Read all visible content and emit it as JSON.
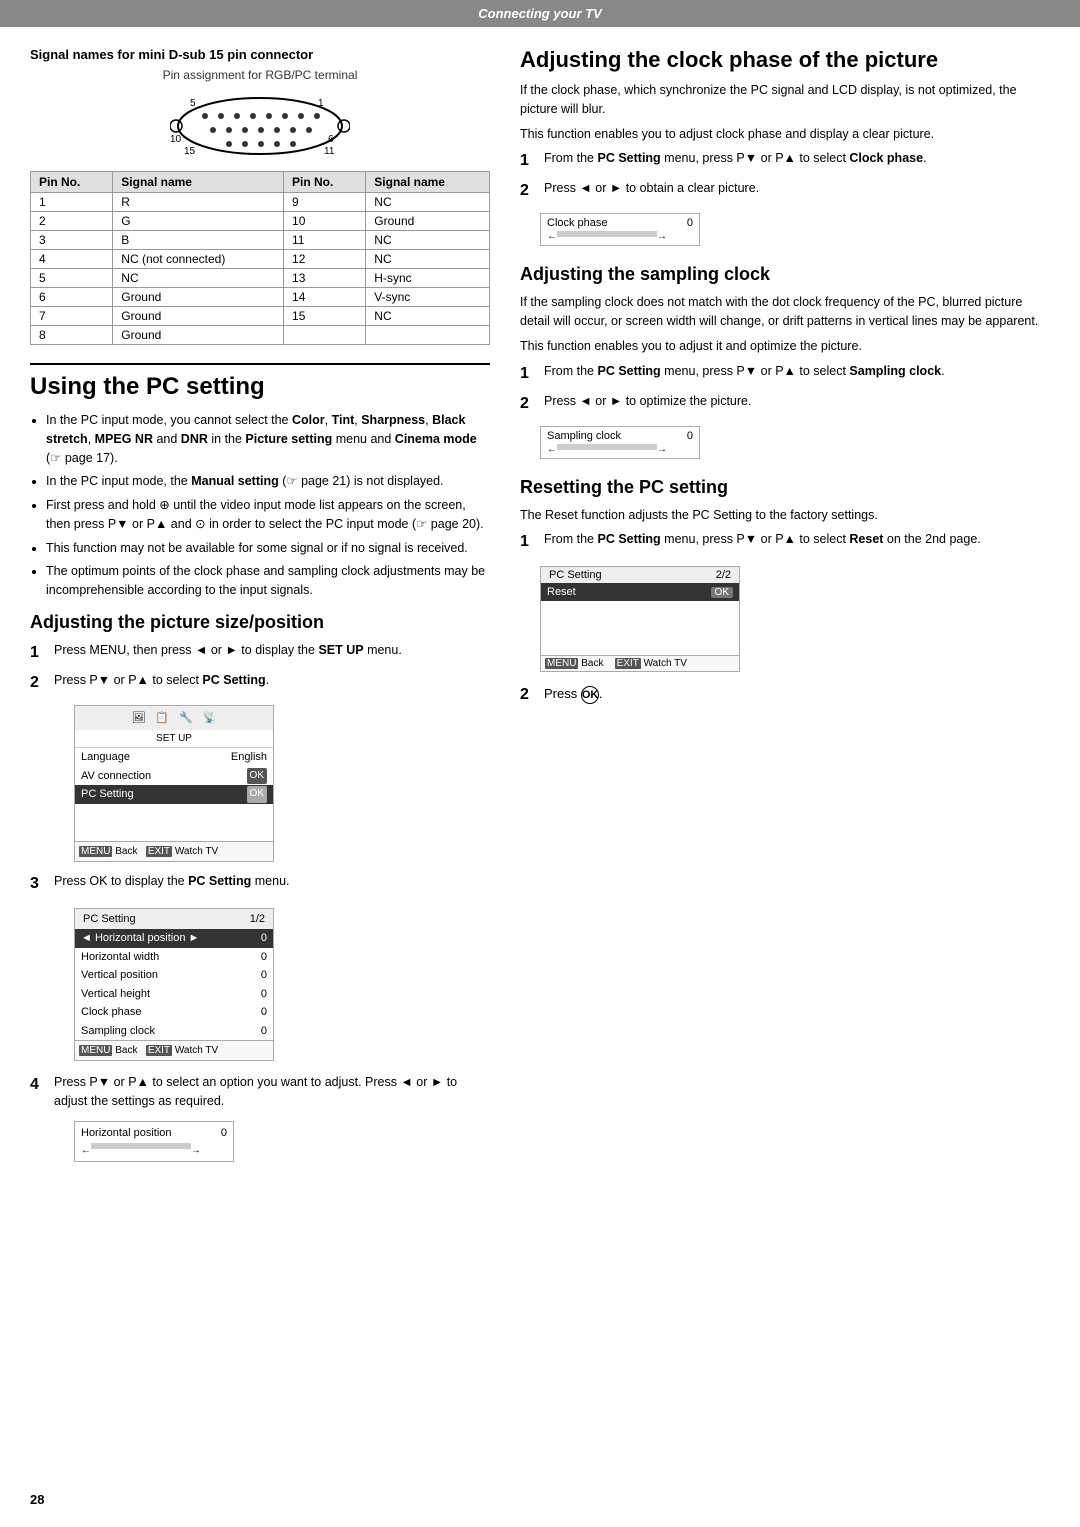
{
  "header": {
    "title": "Connecting your TV"
  },
  "left": {
    "signal_section": {
      "title": "Signal names for mini D-sub 15 pin connector",
      "pin_assignment_label": "Pin assignment for RGB/PC terminal",
      "table_headers": [
        "Pin No.",
        "Signal name",
        "Pin No.",
        "Signal name"
      ],
      "table_rows": [
        [
          "1",
          "R",
          "9",
          "NC"
        ],
        [
          "2",
          "G",
          "10",
          "Ground"
        ],
        [
          "3",
          "B",
          "11",
          "NC"
        ],
        [
          "4",
          "NC (not connected)",
          "12",
          "NC"
        ],
        [
          "5",
          "NC",
          "13",
          "H-sync"
        ],
        [
          "6",
          "Ground",
          "14",
          "V-sync"
        ],
        [
          "7",
          "Ground",
          "15",
          "NC"
        ],
        [
          "8",
          "Ground",
          "",
          ""
        ]
      ]
    },
    "using_pc": {
      "heading": "Using the PC setting",
      "bullets": [
        "In the PC input mode, you cannot select the Color, Tint, Sharpness, Black stretch, MPEG NR and DNR in the Picture setting menu and Cinema mode (☞ page 17).",
        "In the PC input mode, the Manual setting (☞ page 21) is not displayed.",
        "First press and hold ⊕ until the video input mode list appears on the screen, then press P▼ or P▲ and ⊙ in order to select the PC input mode (☞ page 20).",
        "This function may not be available for some signal or if no signal is received.",
        "The optimum points of the clock phase and sampling clock adjustments may be incomprehensible according to the input signals."
      ]
    },
    "adjust_picture": {
      "heading": "Adjusting the picture size/position",
      "steps": [
        {
          "num": "1",
          "text": "Press MENU, then press ◄ or ► to display the SET UP menu."
        },
        {
          "num": "2",
          "text": "Press P▼ or P▲ to select PC Setting."
        },
        {
          "num": "3",
          "text": "Press OK to display the PC Setting menu."
        },
        {
          "num": "4",
          "text": "Press P▼ or P▲ to select an option you want to adjust. Press ◄ or ► to adjust the settings as required."
        }
      ],
      "setup_screen": {
        "icons": [
          "🖼",
          "📋",
          "🔧",
          "📡"
        ],
        "title": "SET UP",
        "rows": [
          {
            "label": "Language",
            "value": "English",
            "active": false
          },
          {
            "label": "AV connection",
            "value": "OK",
            "active": false
          },
          {
            "label": "PC Setting",
            "value": "OK",
            "active": true
          }
        ],
        "footer": "MENU Back   EXIT Watch TV"
      },
      "pc_setting_screen": {
        "title": "PC Setting",
        "page": "1/2",
        "rows": [
          {
            "label": "Horizontal position",
            "value": "0",
            "active": true,
            "arrows": true
          },
          {
            "label": "Horizontal width",
            "value": "0",
            "active": false
          },
          {
            "label": "Vertical position",
            "value": "0",
            "active": false
          },
          {
            "label": "Vertical height",
            "value": "0",
            "active": false
          },
          {
            "label": "Clock phase",
            "value": "0",
            "active": false
          },
          {
            "label": "Sampling clock",
            "value": "0",
            "active": false
          }
        ],
        "footer": "MENU Back   EXIT Watch TV"
      },
      "bar_screen": {
        "label": "Horizontal position",
        "value": "0",
        "left_arrow": "←",
        "right_arrow": "→"
      }
    }
  },
  "right": {
    "clock_phase": {
      "heading": "Adjusting the clock phase of the picture",
      "body1": "If the clock phase, which synchronize the PC signal and LCD display, is not optimized, the picture will blur.",
      "body2": "This function enables you to adjust clock phase and display a clear picture.",
      "steps": [
        {
          "num": "1",
          "text": "From the PC Setting menu, press P▼ or P▲ to select Clock phase."
        },
        {
          "num": "2",
          "text": "Press ◄ or ► to obtain a clear picture."
        }
      ],
      "bar_screen": {
        "label": "Clock phase",
        "value": "0",
        "left_arrow": "←",
        "right_arrow": "→"
      }
    },
    "sampling_clock": {
      "heading": "Adjusting the sampling clock",
      "body1": "If the sampling clock does not match with the dot clock frequency of the PC, blurred picture detail will occur, or screen width will change, or drift patterns in vertical lines may be apparent.",
      "body2": "This function enables you to adjust it and optimize the picture.",
      "steps": [
        {
          "num": "1",
          "text": "From the PC Setting menu, press P▼ or P▲ to select Sampling clock."
        },
        {
          "num": "2",
          "text": "Press ◄ or ► to optimize the picture."
        }
      ],
      "bar_screen": {
        "label": "Sampling clock",
        "value": "0",
        "left_arrow": "←",
        "right_arrow": "→"
      }
    },
    "resetting": {
      "heading": "Resetting the PC setting",
      "body1": "The Reset function adjusts the PC Setting to the factory settings.",
      "steps": [
        {
          "num": "1",
          "text": "From the PC Setting menu, press P▼ or P▲ to select Reset on the 2nd page."
        },
        {
          "num": "2",
          "text": "Press OK."
        }
      ],
      "reset_screen": {
        "title": "PC Setting",
        "page": "2/2",
        "rows": [
          {
            "label": "Reset",
            "value": "OK",
            "active": true
          }
        ],
        "empty_rows": 3,
        "footer": "MENU Back   EXIT Watch TV"
      }
    }
  },
  "footer": {
    "page_number": "28"
  }
}
